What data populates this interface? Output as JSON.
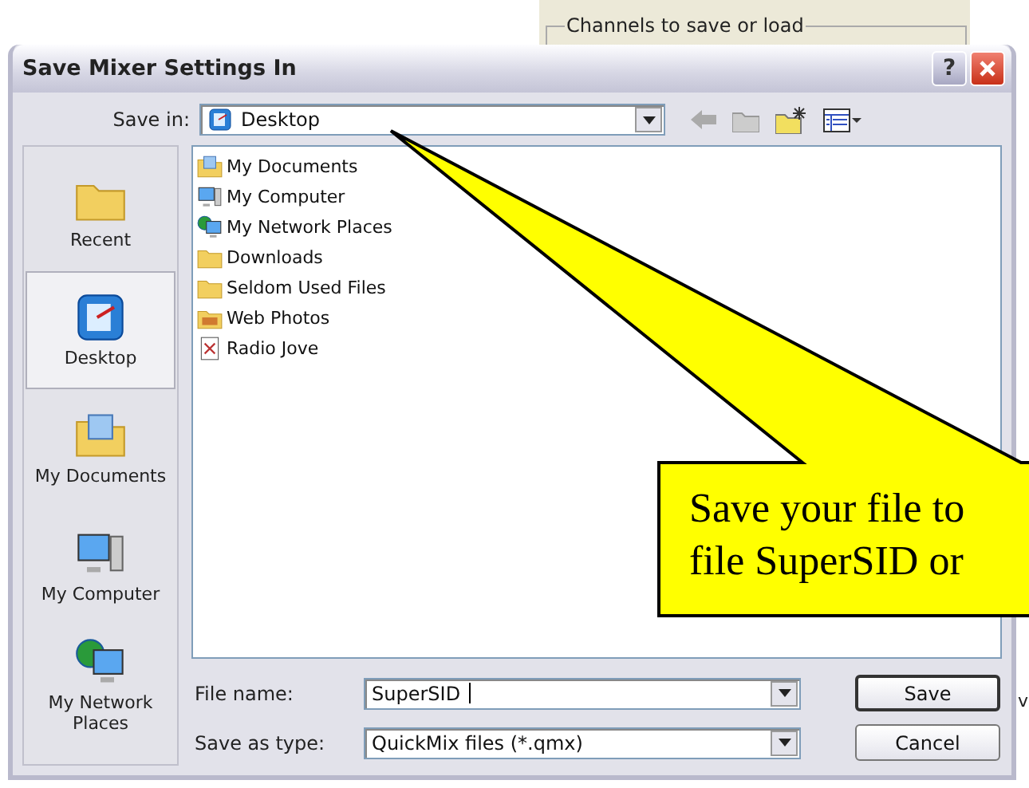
{
  "background_window": {
    "group_label": "Channels to save or load",
    "cut_text": "v"
  },
  "dialog": {
    "title": "Save Mixer Settings In",
    "help": "?",
    "save_in": {
      "label": "Save in:",
      "value": "Desktop"
    },
    "places": [
      {
        "label": "Recent",
        "kind": "recent",
        "selected": false
      },
      {
        "label": "Desktop",
        "kind": "desktop",
        "selected": true
      },
      {
        "label": "My Documents",
        "kind": "documents",
        "selected": false
      },
      {
        "label": "My Computer",
        "kind": "computer",
        "selected": false
      },
      {
        "label": "My Network Places",
        "kind": "network",
        "selected": false
      }
    ],
    "files": [
      {
        "name": "My Documents",
        "kind": "documents"
      },
      {
        "name": "My Computer",
        "kind": "computer"
      },
      {
        "name": "My Network Places",
        "kind": "network"
      },
      {
        "name": "Downloads",
        "kind": "folder"
      },
      {
        "name": "Seldom Used Files",
        "kind": "folder"
      },
      {
        "name": "Web Photos",
        "kind": "photos"
      },
      {
        "name": "Radio Jove",
        "kind": "shortcut"
      }
    ],
    "file_name": {
      "label": "File name:",
      "value": "SuperSID"
    },
    "save_as_type": {
      "label": "Save as type:",
      "value": "QuickMix files (*.qmx)"
    },
    "buttons": [
      {
        "label": "Save",
        "default": true
      },
      {
        "label": "Cancel",
        "default": false
      }
    ]
  },
  "callout": {
    "lines": [
      "Save your file to",
      "file SuperSID or"
    ]
  }
}
